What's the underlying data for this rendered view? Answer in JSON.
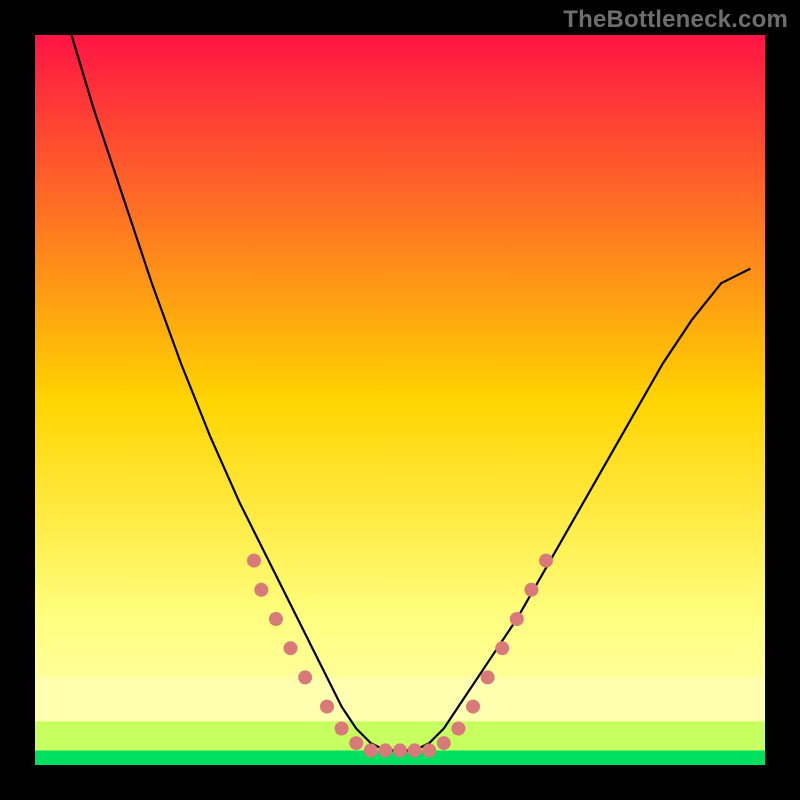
{
  "watermark": "TheBottleneck.com",
  "chart_data": {
    "type": "line",
    "title": "",
    "xlabel": "",
    "ylabel": "",
    "xlim": [
      0,
      1
    ],
    "ylim": [
      0,
      1
    ],
    "note": "Axes unlabeled in image; values are normalized fractions of plot width/height estimated from pixels.",
    "series": [
      {
        "name": "curve",
        "x": [
          0.05,
          0.08,
          0.12,
          0.16,
          0.2,
          0.24,
          0.28,
          0.32,
          0.36,
          0.38,
          0.4,
          0.42,
          0.44,
          0.46,
          0.48,
          0.5,
          0.52,
          0.54,
          0.56,
          0.58,
          0.62,
          0.66,
          0.7,
          0.74,
          0.78,
          0.82,
          0.86,
          0.9,
          0.94,
          0.98
        ],
        "y": [
          1.0,
          0.9,
          0.78,
          0.66,
          0.55,
          0.45,
          0.36,
          0.28,
          0.2,
          0.16,
          0.12,
          0.08,
          0.05,
          0.03,
          0.02,
          0.02,
          0.02,
          0.03,
          0.05,
          0.08,
          0.14,
          0.2,
          0.27,
          0.34,
          0.41,
          0.48,
          0.55,
          0.61,
          0.66,
          0.68
        ]
      }
    ],
    "markers": {
      "name": "dots",
      "color": "#d97a7a",
      "x": [
        0.3,
        0.31,
        0.33,
        0.35,
        0.37,
        0.4,
        0.42,
        0.44,
        0.46,
        0.48,
        0.5,
        0.52,
        0.54,
        0.56,
        0.58,
        0.6,
        0.62,
        0.64,
        0.66,
        0.68,
        0.7
      ],
      "y": [
        0.28,
        0.24,
        0.2,
        0.16,
        0.12,
        0.08,
        0.05,
        0.03,
        0.02,
        0.02,
        0.02,
        0.02,
        0.02,
        0.03,
        0.05,
        0.08,
        0.12,
        0.16,
        0.2,
        0.24,
        0.28
      ]
    },
    "bands": [
      {
        "name": "green-band",
        "y_from": 0.0,
        "y_to": 0.02,
        "color": "#00e060"
      },
      {
        "name": "lime-band",
        "y_from": 0.02,
        "y_to": 0.06,
        "color": "#c8ff60"
      },
      {
        "name": "cream-band",
        "y_from": 0.06,
        "y_to": 0.12,
        "color": "#ffffb0"
      }
    ],
    "gradient_stops": [
      {
        "offset": 0.0,
        "color": "#ff1444"
      },
      {
        "offset": 0.5,
        "color": "#ffd400"
      },
      {
        "offset": 0.8,
        "color": "#ffff80"
      },
      {
        "offset": 1.0,
        "color": "#ffffc0"
      }
    ]
  }
}
